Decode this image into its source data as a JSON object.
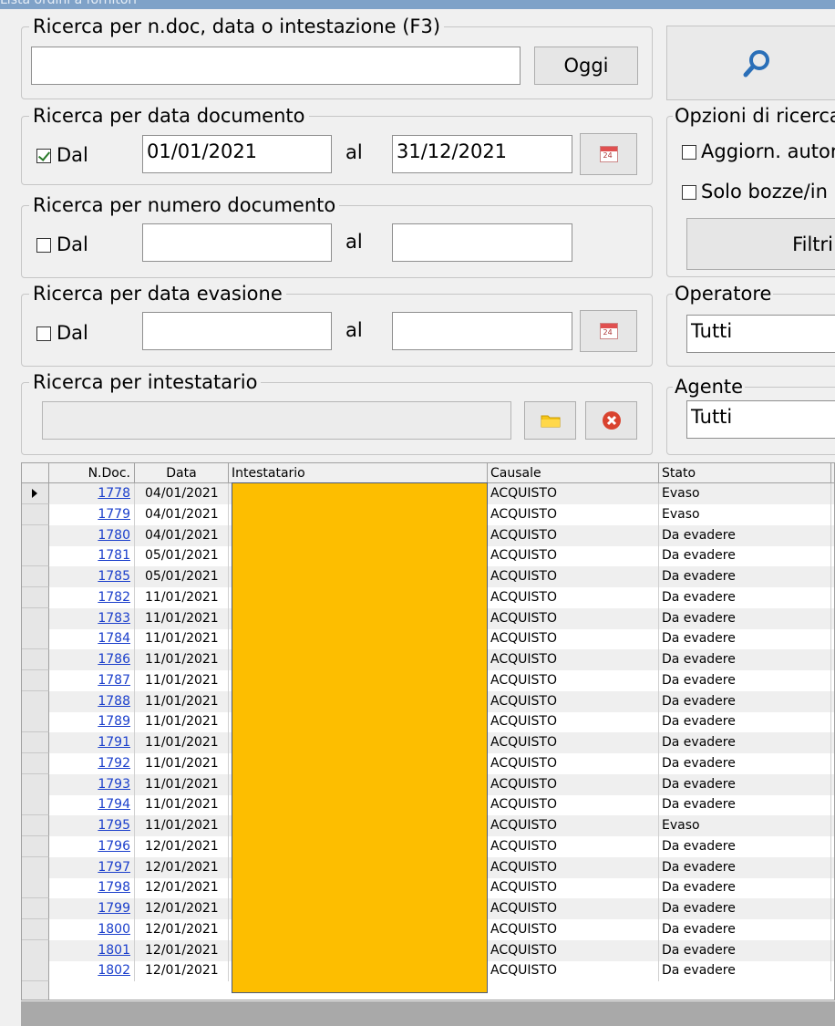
{
  "window": {
    "title": "Lista ordini a fornitori"
  },
  "search_main": {
    "legend": "Ricerca per n.doc, data o intestazione (F3)",
    "value": "",
    "today_button": "Oggi"
  },
  "search_button": {
    "icon": "search-icon"
  },
  "date_doc": {
    "legend": "Ricerca per data documento",
    "checkbox_label": "Dal",
    "checked": true,
    "from": "01/01/2021",
    "to_label": "al",
    "to": "31/12/2021"
  },
  "num_doc": {
    "legend": "Ricerca per numero documento",
    "checkbox_label": "Dal",
    "checked": false,
    "from": "",
    "to_label": "al",
    "to": ""
  },
  "date_evasion": {
    "legend": "Ricerca per data evasione",
    "checkbox_label": "Dal",
    "checked": false,
    "from": "",
    "to_label": "al",
    "to": ""
  },
  "holder": {
    "legend": "Ricerca per intestatario",
    "value": ""
  },
  "options": {
    "legend": "Opzioni di ricerca",
    "auto_update": "Aggiorn. autor",
    "drafts_only": "Solo bozze/in",
    "filters_button": "Filtri"
  },
  "operator": {
    "legend": "Operatore",
    "value": "Tutti"
  },
  "agent": {
    "legend": "Agente",
    "value": "Tutti"
  },
  "grid": {
    "columns": [
      "N.Doc.",
      "Data",
      "Intestatario",
      "Causale",
      "Stato"
    ],
    "rows": [
      {
        "ndoc": "1778",
        "date": "04/01/2021",
        "causale": "ACQUISTO",
        "stato": "Evaso"
      },
      {
        "ndoc": "1779",
        "date": "04/01/2021",
        "causale": "ACQUISTO",
        "stato": "Evaso"
      },
      {
        "ndoc": "1780",
        "date": "04/01/2021",
        "causale": "ACQUISTO",
        "stato": "Da evadere"
      },
      {
        "ndoc": "1781",
        "date": "05/01/2021",
        "causale": "ACQUISTO",
        "stato": "Da evadere"
      },
      {
        "ndoc": "1785",
        "date": "05/01/2021",
        "causale": "ACQUISTO",
        "stato": "Da evadere"
      },
      {
        "ndoc": "1782",
        "date": "11/01/2021",
        "causale": "ACQUISTO",
        "stato": "Da evadere"
      },
      {
        "ndoc": "1783",
        "date": "11/01/2021",
        "causale": "ACQUISTO",
        "stato": "Da evadere"
      },
      {
        "ndoc": "1784",
        "date": "11/01/2021",
        "causale": "ACQUISTO",
        "stato": "Da evadere"
      },
      {
        "ndoc": "1786",
        "date": "11/01/2021",
        "causale": "ACQUISTO",
        "stato": "Da evadere"
      },
      {
        "ndoc": "1787",
        "date": "11/01/2021",
        "causale": "ACQUISTO",
        "stato": "Da evadere"
      },
      {
        "ndoc": "1788",
        "date": "11/01/2021",
        "causale": "ACQUISTO",
        "stato": "Da evadere"
      },
      {
        "ndoc": "1789",
        "date": "11/01/2021",
        "causale": "ACQUISTO",
        "stato": "Da evadere"
      },
      {
        "ndoc": "1791",
        "date": "11/01/2021",
        "causale": "ACQUISTO",
        "stato": "Da evadere"
      },
      {
        "ndoc": "1792",
        "date": "11/01/2021",
        "causale": "ACQUISTO",
        "stato": "Da evadere"
      },
      {
        "ndoc": "1793",
        "date": "11/01/2021",
        "causale": "ACQUISTO",
        "stato": "Da evadere"
      },
      {
        "ndoc": "1794",
        "date": "11/01/2021",
        "causale": "ACQUISTO",
        "stato": "Da evadere"
      },
      {
        "ndoc": "1795",
        "date": "11/01/2021",
        "causale": "ACQUISTO",
        "stato": "Evaso"
      },
      {
        "ndoc": "1796",
        "date": "12/01/2021",
        "causale": "ACQUISTO",
        "stato": "Da evadere"
      },
      {
        "ndoc": "1797",
        "date": "12/01/2021",
        "causale": "ACQUISTO",
        "stato": "Da evadere"
      },
      {
        "ndoc": "1798",
        "date": "12/01/2021",
        "causale": "ACQUISTO",
        "stato": "Da evadere"
      },
      {
        "ndoc": "1799",
        "date": "12/01/2021",
        "causale": "ACQUISTO",
        "stato": "Da evadere"
      },
      {
        "ndoc": "1800",
        "date": "12/01/2021",
        "causale": "ACQUISTO",
        "stato": "Da evadere"
      },
      {
        "ndoc": "1801",
        "date": "12/01/2021",
        "causale": "ACQUISTO",
        "stato": "Da evadere"
      },
      {
        "ndoc": "1802",
        "date": "12/01/2021",
        "causale": "ACQUISTO",
        "stato": "Da evadere"
      }
    ],
    "redaction_color": "#fdbe00"
  }
}
